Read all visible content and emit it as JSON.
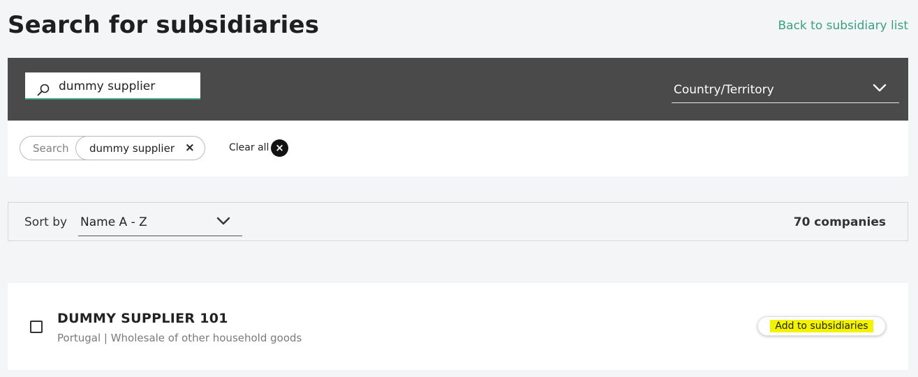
{
  "header": {
    "title": "Search for subsidiaries",
    "back_link": "Back to subsidiary list"
  },
  "filters": {
    "search_value": "dummy supplier",
    "country_label": "Country/Territory",
    "icons": {
      "search": "search-icon",
      "country": "chevron-down-icon"
    }
  },
  "chips": {
    "key": "Search",
    "value": "dummy supplier",
    "remove": "×",
    "clear_all": "Clear all",
    "clear_all_icon": "×"
  },
  "sort": {
    "label": "Sort by",
    "value": "Name A - Z",
    "result_count": "70 companies"
  },
  "results": [
    {
      "name": "DUMMY SUPPLIER 101",
      "meta": "Portugal | Wholesale of other household goods",
      "checked": false,
      "action": "Add to subsidiaries"
    }
  ],
  "colors": {
    "accent": "#3aa17e",
    "filter_bar": "#4a4a4a",
    "highlight": "#f3f300",
    "page_bg": "#f4f5f7"
  }
}
